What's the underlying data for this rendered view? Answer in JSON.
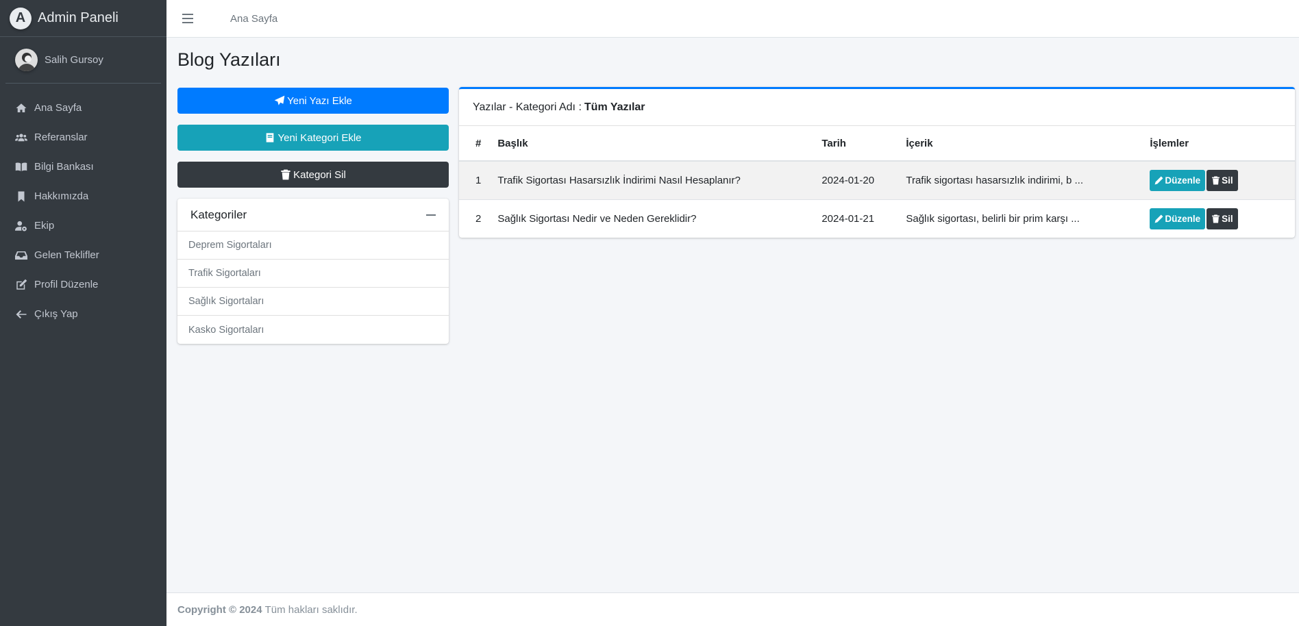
{
  "brand": {
    "logo_letter": "A",
    "title": "Admin Paneli"
  },
  "user": {
    "name": "Salih Gursoy"
  },
  "sidebar": {
    "items": [
      {
        "label": "Ana Sayfa",
        "icon": "home-icon"
      },
      {
        "label": "Referanslar",
        "icon": "users-icon"
      },
      {
        "label": "Bilgi Bankası",
        "icon": "book-icon"
      },
      {
        "label": "Hakkımızda",
        "icon": "bookmark-icon"
      },
      {
        "label": "Ekip",
        "icon": "user-cog-icon"
      },
      {
        "label": "Gelen Teklifler",
        "icon": "inbox-icon"
      },
      {
        "label": "Profil Düzenle",
        "icon": "edit-icon"
      },
      {
        "label": "Çıkış Yap",
        "icon": "arrow-left-icon"
      }
    ]
  },
  "topbar": {
    "home_link": "Ana Sayfa"
  },
  "page": {
    "title": "Blog Yazıları"
  },
  "actions": {
    "new_post": "Yeni Yazı Ekle",
    "new_category": "Yeni Kategori Ekle",
    "delete_category": "Kategori Sil"
  },
  "categories": {
    "title": "Kategoriler",
    "items": [
      "Deprem Sigortaları",
      "Trafik Sigortaları",
      "Sağlık Sigortaları",
      "Kasko Sigortaları"
    ]
  },
  "posts_card": {
    "header_prefix": "Yazılar - Kategori Adı :",
    "header_category": "Tüm Yazılar",
    "columns": [
      "#",
      "Başlık",
      "Tarih",
      "İçerik",
      "İşlemler"
    ],
    "rows": [
      {
        "num": "1",
        "title": "Trafik Sigortası Hasarsızlık İndirimi Nasıl Hesaplanır?",
        "date": "2024-01-20",
        "content": "Trafik sigortası hasarsızlık indirimi, b ..."
      },
      {
        "num": "2",
        "title": "Sağlık Sigortası Nedir ve Neden Gereklidir?",
        "date": "2024-01-21",
        "content": "Sağlık sigortası, belirli bir prim karşı ..."
      }
    ],
    "edit_label": "Düzenle",
    "delete_label": "Sil"
  },
  "footer": {
    "copyright": "Copyright © 2024",
    "rights": "Tüm hakları saklıdır."
  },
  "colors": {
    "primary": "#007bff",
    "info": "#17a2b8",
    "dark": "#343a40"
  }
}
